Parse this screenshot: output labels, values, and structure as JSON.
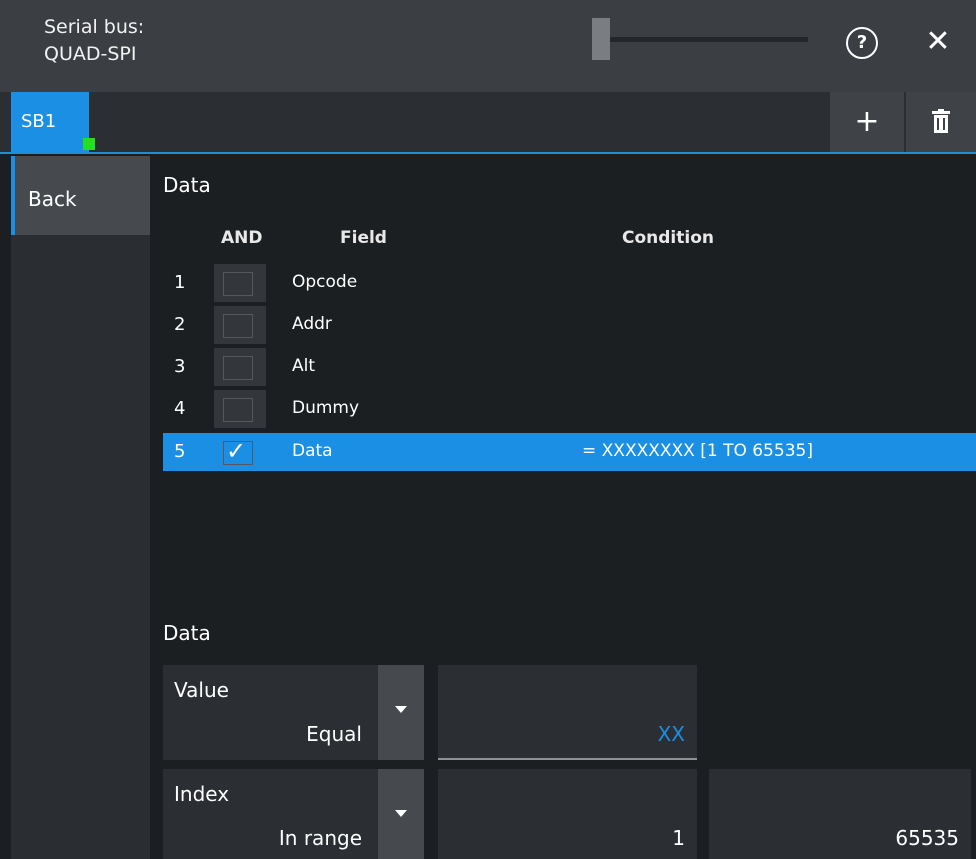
{
  "header": {
    "title_line1": "Serial bus:",
    "title_line2": "QUAD-SPI",
    "help_glyph": "?",
    "close_glyph": "✕"
  },
  "tabs": {
    "active_label": "SB1",
    "indicator_color": "#22e01f",
    "add_glyph": "+",
    "delete_icon": "trash-icon"
  },
  "sidebar": {
    "back_label": "Back"
  },
  "data_section": {
    "title": "Data",
    "columns": {
      "and": "AND",
      "field": "Field",
      "condition": "Condition"
    },
    "rows": [
      {
        "num": "1",
        "field": "Opcode",
        "checked": false,
        "condition": ""
      },
      {
        "num": "2",
        "field": "Addr",
        "checked": false,
        "condition": ""
      },
      {
        "num": "3",
        "field": "Alt",
        "checked": false,
        "condition": ""
      },
      {
        "num": "4",
        "field": "Dummy",
        "checked": false,
        "condition": ""
      },
      {
        "num": "5",
        "field": "Data",
        "checked": true,
        "condition": "= XXXXXXXX [1 TO 65535]",
        "selected": true
      }
    ]
  },
  "settings": {
    "title": "Data",
    "value": {
      "label": "Value",
      "selected": "Equal",
      "input": "XX"
    },
    "index": {
      "label": "Index",
      "selected": "In range",
      "from": "1",
      "to": "65535"
    }
  },
  "colors": {
    "accent": "#1a8fe3",
    "background": "#1c1f22",
    "panel": "#2b2f33"
  }
}
